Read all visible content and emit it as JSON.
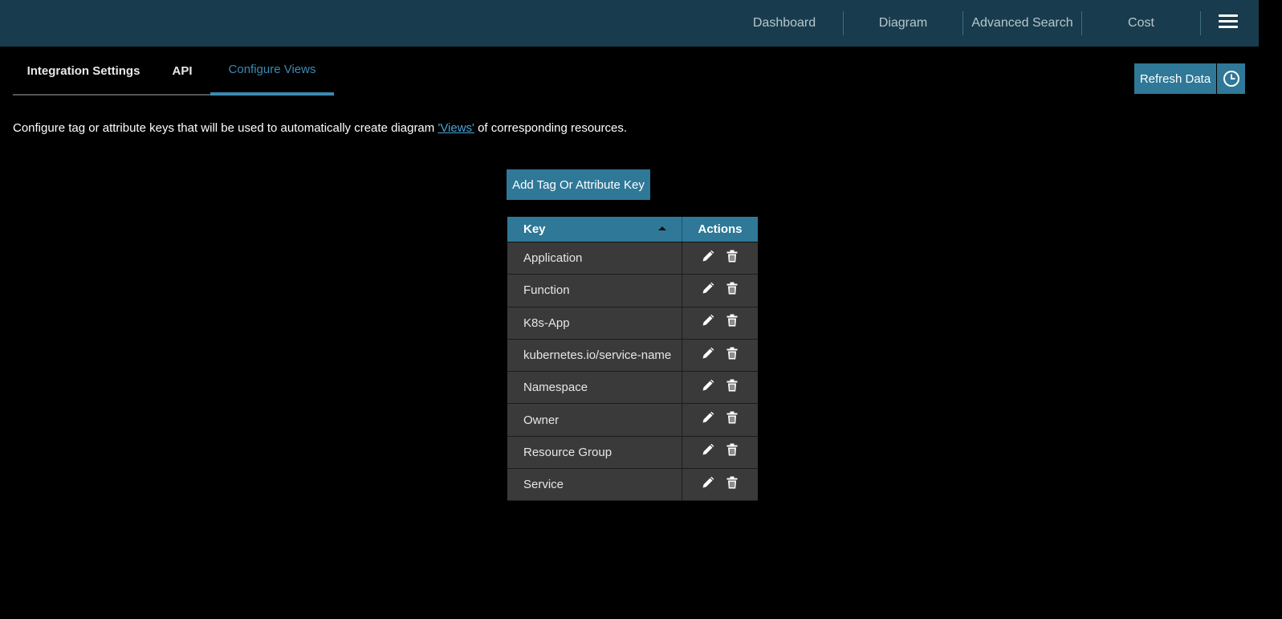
{
  "topnav": {
    "items": [
      {
        "label": "Dashboard"
      },
      {
        "label": "Diagram"
      },
      {
        "label": "Advanced Search"
      },
      {
        "label": "Cost"
      }
    ],
    "menu_icon": "hamburger-menu-icon"
  },
  "tabs": [
    {
      "label": "Integration Settings",
      "active": false
    },
    {
      "label": "API",
      "active": false
    },
    {
      "label": "Configure Views",
      "active": true
    }
  ],
  "toolbar": {
    "refresh_label": "Refresh Data",
    "history_icon": "clock-icon"
  },
  "description": {
    "before": "Configure tag or attribute keys that will be used to automatically create diagram ",
    "link": "'Views'",
    "after": " of corresponding resources."
  },
  "add_button_label": "Add Tag Or Attribute Key",
  "table": {
    "headers": {
      "key": "Key",
      "actions": "Actions"
    },
    "sort": "ascending",
    "rows": [
      {
        "key": "Application"
      },
      {
        "key": "Function"
      },
      {
        "key": "K8s-App"
      },
      {
        "key": "kubernetes.io/service-name"
      },
      {
        "key": "Namespace"
      },
      {
        "key": "Owner"
      },
      {
        "key": "Resource Group"
      },
      {
        "key": "Service"
      }
    ],
    "action_icons": [
      "pencil-icon",
      "trash-icon"
    ]
  },
  "colors": {
    "topbar": "#183c4d",
    "accent": "#2f7897",
    "active_tab": "#3b8ab3",
    "link": "#4aa3d6",
    "row_bg": "#3a3a3a"
  }
}
